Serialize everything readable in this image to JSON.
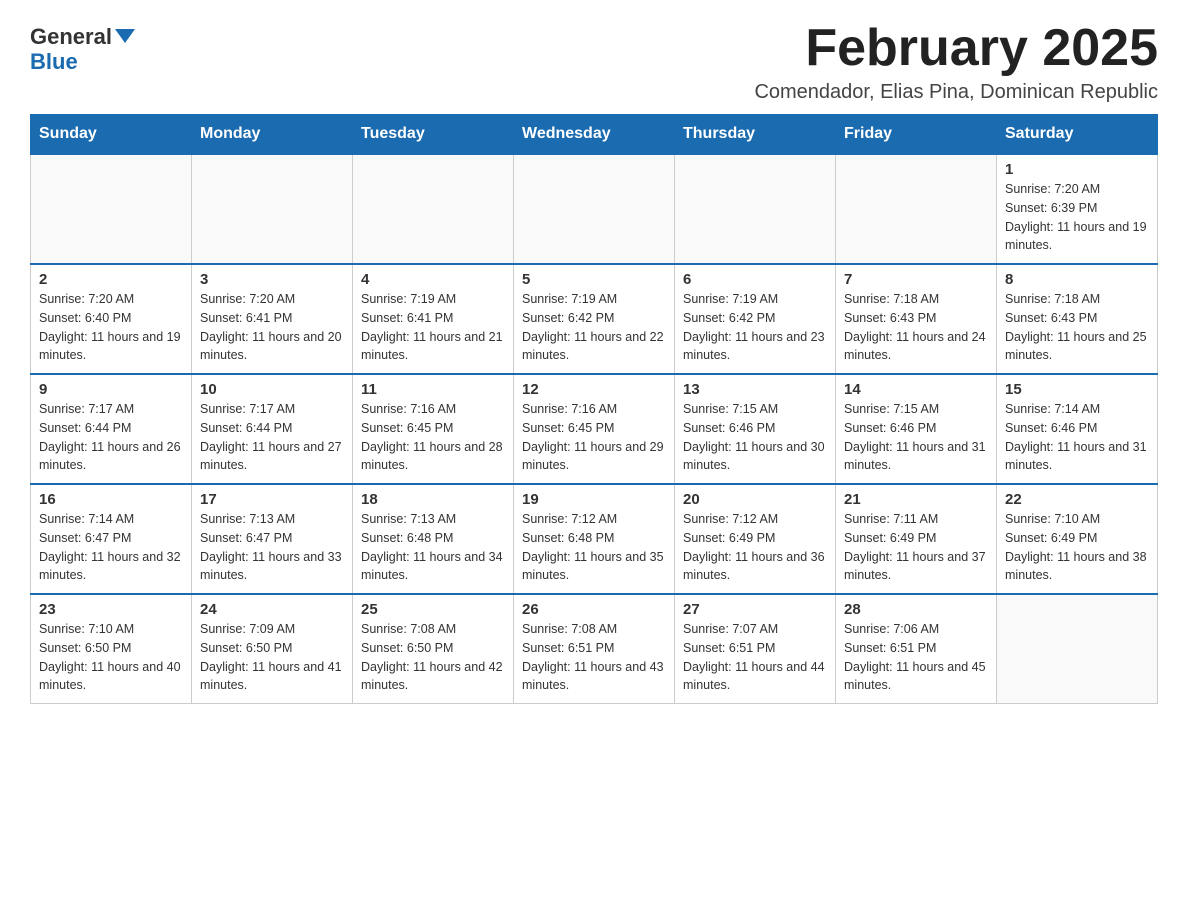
{
  "logo": {
    "text_general": "General",
    "text_blue": "Blue"
  },
  "header": {
    "month_year": "February 2025",
    "location": "Comendador, Elias Pina, Dominican Republic"
  },
  "days_of_week": [
    "Sunday",
    "Monday",
    "Tuesday",
    "Wednesday",
    "Thursday",
    "Friday",
    "Saturday"
  ],
  "weeks": [
    [
      {
        "day": "",
        "info": ""
      },
      {
        "day": "",
        "info": ""
      },
      {
        "day": "",
        "info": ""
      },
      {
        "day": "",
        "info": ""
      },
      {
        "day": "",
        "info": ""
      },
      {
        "day": "",
        "info": ""
      },
      {
        "day": "1",
        "info": "Sunrise: 7:20 AM\nSunset: 6:39 PM\nDaylight: 11 hours and 19 minutes."
      }
    ],
    [
      {
        "day": "2",
        "info": "Sunrise: 7:20 AM\nSunset: 6:40 PM\nDaylight: 11 hours and 19 minutes."
      },
      {
        "day": "3",
        "info": "Sunrise: 7:20 AM\nSunset: 6:41 PM\nDaylight: 11 hours and 20 minutes."
      },
      {
        "day": "4",
        "info": "Sunrise: 7:19 AM\nSunset: 6:41 PM\nDaylight: 11 hours and 21 minutes."
      },
      {
        "day": "5",
        "info": "Sunrise: 7:19 AM\nSunset: 6:42 PM\nDaylight: 11 hours and 22 minutes."
      },
      {
        "day": "6",
        "info": "Sunrise: 7:19 AM\nSunset: 6:42 PM\nDaylight: 11 hours and 23 minutes."
      },
      {
        "day": "7",
        "info": "Sunrise: 7:18 AM\nSunset: 6:43 PM\nDaylight: 11 hours and 24 minutes."
      },
      {
        "day": "8",
        "info": "Sunrise: 7:18 AM\nSunset: 6:43 PM\nDaylight: 11 hours and 25 minutes."
      }
    ],
    [
      {
        "day": "9",
        "info": "Sunrise: 7:17 AM\nSunset: 6:44 PM\nDaylight: 11 hours and 26 minutes."
      },
      {
        "day": "10",
        "info": "Sunrise: 7:17 AM\nSunset: 6:44 PM\nDaylight: 11 hours and 27 minutes."
      },
      {
        "day": "11",
        "info": "Sunrise: 7:16 AM\nSunset: 6:45 PM\nDaylight: 11 hours and 28 minutes."
      },
      {
        "day": "12",
        "info": "Sunrise: 7:16 AM\nSunset: 6:45 PM\nDaylight: 11 hours and 29 minutes."
      },
      {
        "day": "13",
        "info": "Sunrise: 7:15 AM\nSunset: 6:46 PM\nDaylight: 11 hours and 30 minutes."
      },
      {
        "day": "14",
        "info": "Sunrise: 7:15 AM\nSunset: 6:46 PM\nDaylight: 11 hours and 31 minutes."
      },
      {
        "day": "15",
        "info": "Sunrise: 7:14 AM\nSunset: 6:46 PM\nDaylight: 11 hours and 31 minutes."
      }
    ],
    [
      {
        "day": "16",
        "info": "Sunrise: 7:14 AM\nSunset: 6:47 PM\nDaylight: 11 hours and 32 minutes."
      },
      {
        "day": "17",
        "info": "Sunrise: 7:13 AM\nSunset: 6:47 PM\nDaylight: 11 hours and 33 minutes."
      },
      {
        "day": "18",
        "info": "Sunrise: 7:13 AM\nSunset: 6:48 PM\nDaylight: 11 hours and 34 minutes."
      },
      {
        "day": "19",
        "info": "Sunrise: 7:12 AM\nSunset: 6:48 PM\nDaylight: 11 hours and 35 minutes."
      },
      {
        "day": "20",
        "info": "Sunrise: 7:12 AM\nSunset: 6:49 PM\nDaylight: 11 hours and 36 minutes."
      },
      {
        "day": "21",
        "info": "Sunrise: 7:11 AM\nSunset: 6:49 PM\nDaylight: 11 hours and 37 minutes."
      },
      {
        "day": "22",
        "info": "Sunrise: 7:10 AM\nSunset: 6:49 PM\nDaylight: 11 hours and 38 minutes."
      }
    ],
    [
      {
        "day": "23",
        "info": "Sunrise: 7:10 AM\nSunset: 6:50 PM\nDaylight: 11 hours and 40 minutes."
      },
      {
        "day": "24",
        "info": "Sunrise: 7:09 AM\nSunset: 6:50 PM\nDaylight: 11 hours and 41 minutes."
      },
      {
        "day": "25",
        "info": "Sunrise: 7:08 AM\nSunset: 6:50 PM\nDaylight: 11 hours and 42 minutes."
      },
      {
        "day": "26",
        "info": "Sunrise: 7:08 AM\nSunset: 6:51 PM\nDaylight: 11 hours and 43 minutes."
      },
      {
        "day": "27",
        "info": "Sunrise: 7:07 AM\nSunset: 6:51 PM\nDaylight: 11 hours and 44 minutes."
      },
      {
        "day": "28",
        "info": "Sunrise: 7:06 AM\nSunset: 6:51 PM\nDaylight: 11 hours and 45 minutes."
      },
      {
        "day": "",
        "info": ""
      }
    ]
  ]
}
